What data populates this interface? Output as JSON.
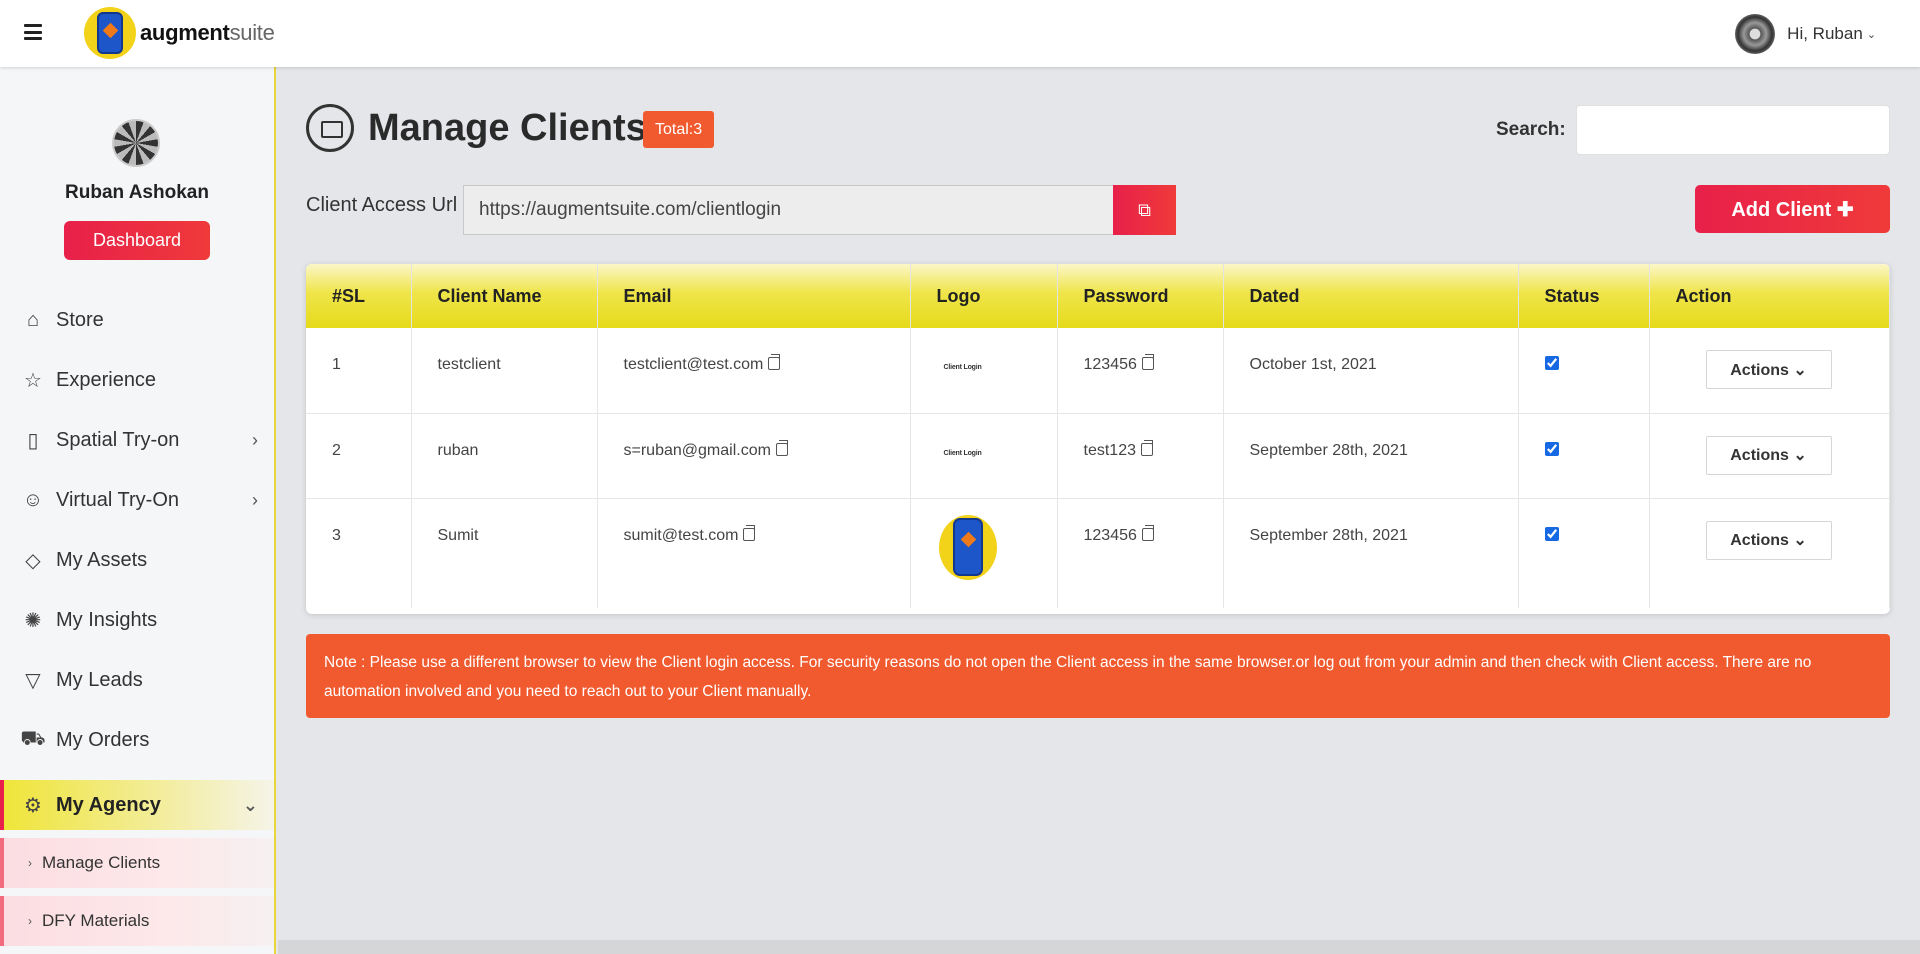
{
  "header": {
    "brand_bold": "augment",
    "brand_light": "suite",
    "greeting": "Hi, Ruban"
  },
  "sidebar": {
    "profile_name": "Ruban Ashokan",
    "dashboard_label": "Dashboard",
    "items": [
      {
        "label": "Store",
        "icon": "store-icon"
      },
      {
        "label": "Experience",
        "icon": "star-icon"
      },
      {
        "label": "Spatial Try-on",
        "icon": "phone-ar-icon",
        "has_children": true
      },
      {
        "label": "Virtual Try-On",
        "icon": "face-scan-icon",
        "has_children": true
      },
      {
        "label": "My Assets",
        "icon": "diamond-icon"
      },
      {
        "label": "My Insights",
        "icon": "lightbulb-icon"
      },
      {
        "label": "My Leads",
        "icon": "funnel-icon"
      },
      {
        "label": "My Orders",
        "icon": "cart-icon"
      }
    ],
    "active_item": {
      "label": "My Agency",
      "icon": "agency-icon"
    },
    "sub_items": [
      {
        "label": "Manage Clients"
      },
      {
        "label": "DFY Materials"
      }
    ]
  },
  "main": {
    "title": "Manage Clients",
    "total_badge": "Total:3",
    "search_label": "Search:",
    "search_value": "",
    "access_label": "Client Access Url",
    "access_url": "https://augmentsuite.com/clientlogin",
    "add_client_label": "Add Client ✚",
    "table": {
      "columns": [
        "#SL",
        "Client Name",
        "Email",
        "Logo",
        "Password",
        "Dated",
        "Status",
        "Action"
      ],
      "rows": [
        {
          "sl": "1",
          "name": "testclient",
          "email": "testclient@test.com",
          "logo_text": "Client Login",
          "password": "123456",
          "dated": "October 1st, 2021",
          "status": true,
          "action": "Actions"
        },
        {
          "sl": "2",
          "name": "ruban",
          "email": "s=ruban@gmail.com",
          "logo_text": "Client Login",
          "password": "test123",
          "dated": "September 28th, 2021",
          "status": true,
          "action": "Actions"
        },
        {
          "sl": "3",
          "name": "Sumit",
          "email": "sumit@test.com",
          "logo_text": "",
          "password": "123456",
          "dated": "September 28th, 2021",
          "status": true,
          "action": "Actions"
        }
      ]
    },
    "note": "Note : Please use a different browser to view the Client login access. For security reasons do not open the Client access in the same browser.or log out from your admin and then check with Client access. There are no automation involved and you need to reach out to your Client manually."
  },
  "colors": {
    "accent_red": "#e8204a",
    "note_orange": "#f15a2f",
    "table_header_yellow": "#efe54a",
    "sidebar_active_border": "#e8204a"
  }
}
